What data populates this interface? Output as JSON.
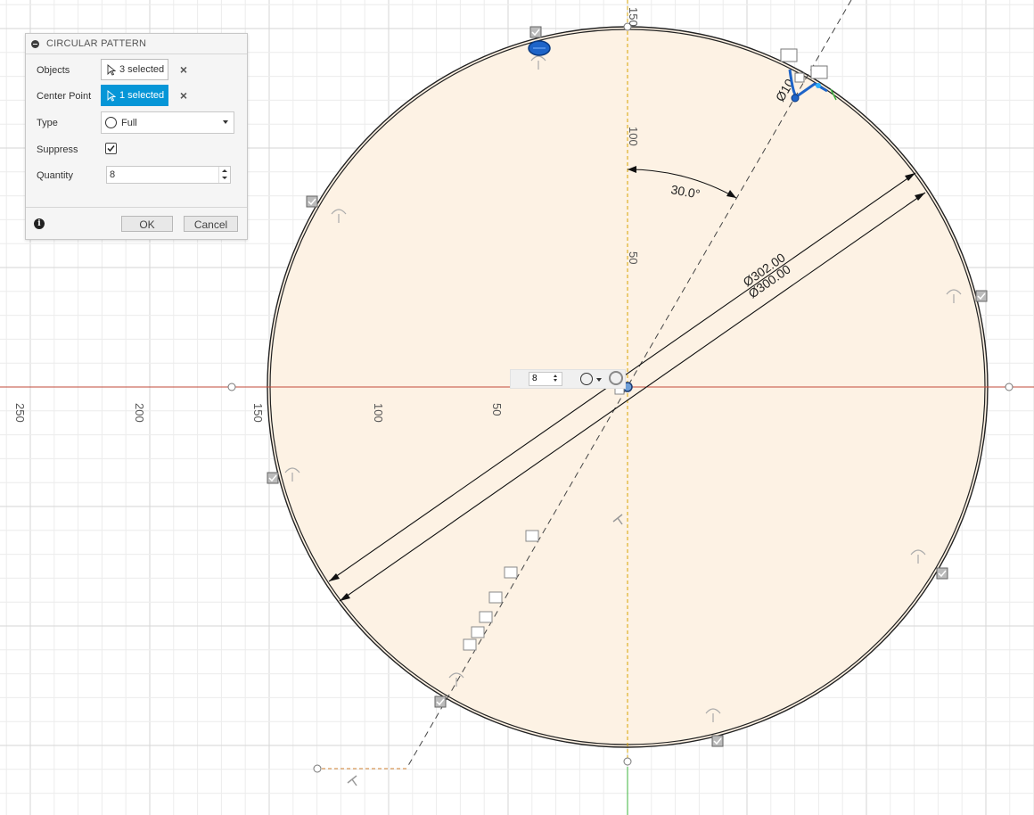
{
  "dialog": {
    "title": "CIRCULAR PATTERN",
    "objects_label": "Objects",
    "objects_value": "3 selected",
    "center_label": "Center Point",
    "center_value": "1 selected",
    "type_label": "Type",
    "type_value": "Full",
    "suppress_label": "Suppress",
    "suppress_checked": true,
    "quantity_label": "Quantity",
    "quantity_value": "8",
    "ok_label": "OK",
    "cancel_label": "Cancel",
    "info_icon": "info-icon"
  },
  "canvas": {
    "quantity_value": "8",
    "angle_dim": "30.0°",
    "dia_outer": "Ø302.00",
    "dia_inner": "Ø300.00",
    "small_dim": "Ø10",
    "ruler_x": [
      "250",
      "200",
      "150",
      "100",
      "50"
    ],
    "ruler_y": [
      "150",
      "100",
      "50"
    ],
    "colors": {
      "fill": "#fdf2e4",
      "grid": "#e6e6e6",
      "axis_x": "#c24a3a",
      "axis_y": "#d9a400",
      "accent": "#0696d7",
      "selection": "#1e64c8"
    }
  }
}
